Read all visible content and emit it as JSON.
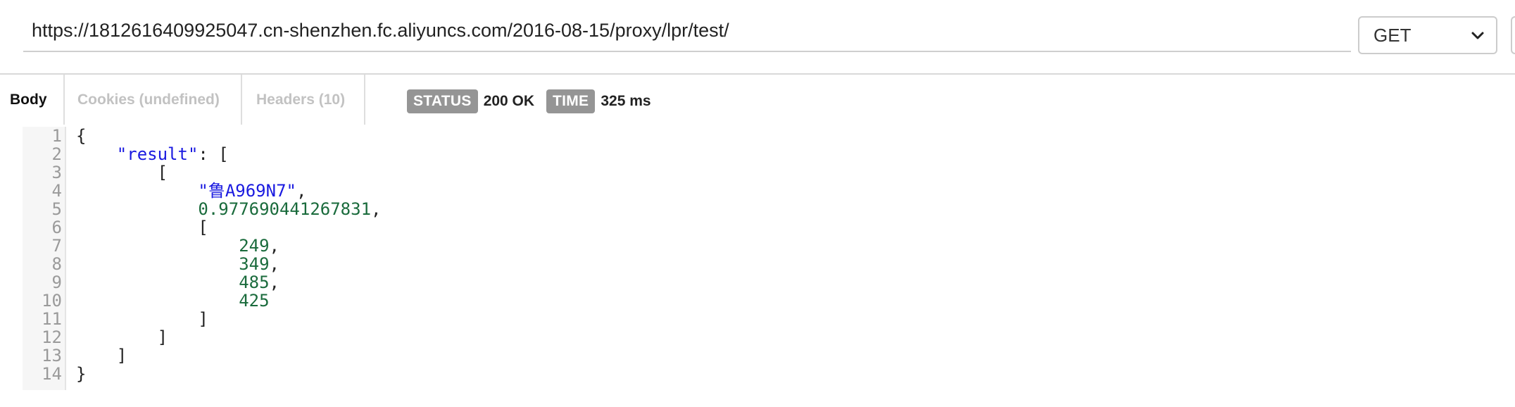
{
  "request": {
    "url": "https://1812616409925047.cn-shenzhen.fc.aliyuncs.com/2016-08-15/proxy/lpr/test/",
    "method": "GET"
  },
  "tabs": [
    {
      "label": "Body",
      "active": true
    },
    {
      "label": "Cookies (undefined)",
      "active": false
    },
    {
      "label": "Headers (10)",
      "active": false
    }
  ],
  "response_meta": {
    "status_label": "STATUS",
    "status_value": "200 OK",
    "time_label": "TIME",
    "time_value": "325 ms"
  },
  "code": {
    "line_numbers": [
      "1",
      "2",
      "3",
      "4",
      "5",
      "6",
      "7",
      "8",
      "9",
      "10",
      "11",
      "12",
      "13",
      "14"
    ],
    "lines": [
      [
        {
          "t": "{",
          "c": ""
        }
      ],
      [
        {
          "t": "    ",
          "c": ""
        },
        {
          "t": "\"result\"",
          "c": "s"
        },
        {
          "t": ": [",
          "c": ""
        }
      ],
      [
        {
          "t": "        [",
          "c": ""
        }
      ],
      [
        {
          "t": "            ",
          "c": ""
        },
        {
          "t": "\"鲁A969N7\"",
          "c": "s"
        },
        {
          "t": ",",
          "c": ""
        }
      ],
      [
        {
          "t": "            ",
          "c": ""
        },
        {
          "t": "0.977690441267831",
          "c": "n"
        },
        {
          "t": ",",
          "c": ""
        }
      ],
      [
        {
          "t": "            [",
          "c": ""
        }
      ],
      [
        {
          "t": "                ",
          "c": ""
        },
        {
          "t": "249",
          "c": "n"
        },
        {
          "t": ",",
          "c": ""
        }
      ],
      [
        {
          "t": "                ",
          "c": ""
        },
        {
          "t": "349",
          "c": "n"
        },
        {
          "t": ",",
          "c": ""
        }
      ],
      [
        {
          "t": "                ",
          "c": ""
        },
        {
          "t": "485",
          "c": "n"
        },
        {
          "t": ",",
          "c": ""
        }
      ],
      [
        {
          "t": "                ",
          "c": ""
        },
        {
          "t": "425",
          "c": "n"
        }
      ],
      [
        {
          "t": "            ]",
          "c": ""
        }
      ],
      [
        {
          "t": "        ]",
          "c": ""
        }
      ],
      [
        {
          "t": "    ]",
          "c": ""
        }
      ],
      [
        {
          "t": "}",
          "c": ""
        }
      ]
    ]
  },
  "colors": {
    "string": "#1a1ae0",
    "number": "#1a6b3c",
    "badge": "#959595"
  }
}
